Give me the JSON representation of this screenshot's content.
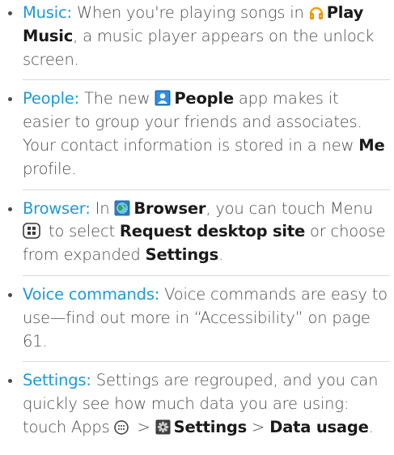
{
  "items": [
    {
      "heading": "Music:",
      "parts": [
        " When you're playing songs in ",
        "Play Music",
        ", a music player appears on the unlock screen."
      ],
      "icons": {
        "play_music": "headphones-icon"
      }
    },
    {
      "heading": "People:",
      "parts": [
        " The new ",
        "People",
        " app makes it easier to group your friends and associates. Your contact information is stored in a new ",
        "Me",
        " profile."
      ],
      "icons": {
        "people": "people-app-icon"
      }
    },
    {
      "heading": "Browser:",
      "parts": [
        " In ",
        "Browser",
        ", you can touch Menu ",
        " to select ",
        "Request desktop site",
        " or choose from expanded ",
        "Settings",
        "."
      ],
      "icons": {
        "browser": "browser-globe-icon",
        "menu": "menu-key-icon"
      }
    },
    {
      "heading": "Voice commands:",
      "parts": [
        " Voice commands are easy to use—find out more in “Accessibility” on page 61."
      ]
    },
    {
      "heading": "Settings:",
      "parts": [
        " Settings are regrouped, and you can quickly see how much data you are using: touch  Apps ",
        " > ",
        "Settings",
        " > ",
        "Data usage",
        "."
      ],
      "icons": {
        "apps": "apps-grid-icon",
        "settings": "gear-icon"
      }
    }
  ],
  "colors": {
    "heading": "#1d9ad6",
    "body": "#4a4a4a",
    "bold": "#1a1a1a",
    "divider": "#d9d9d9"
  }
}
